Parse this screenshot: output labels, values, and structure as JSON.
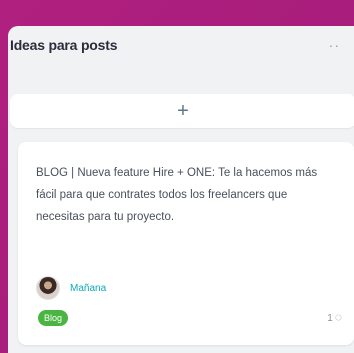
{
  "column": {
    "title": "Ideas para posts",
    "more_label": "··",
    "add_label": "+"
  },
  "card": {
    "text": "BLOG | Nueva feature Hire + ONE: Te la hacemos más fácil para que contrates todos los freelancers que necesitas para tu proyecto.",
    "assignee": {
      "due": "Mañana"
    },
    "tag": "Blog",
    "comments": "1",
    "comment_icon": "comment-icon"
  },
  "colors": {
    "board": "#a61e7c",
    "tag": "#4bb543",
    "due": "#11a9b8"
  }
}
